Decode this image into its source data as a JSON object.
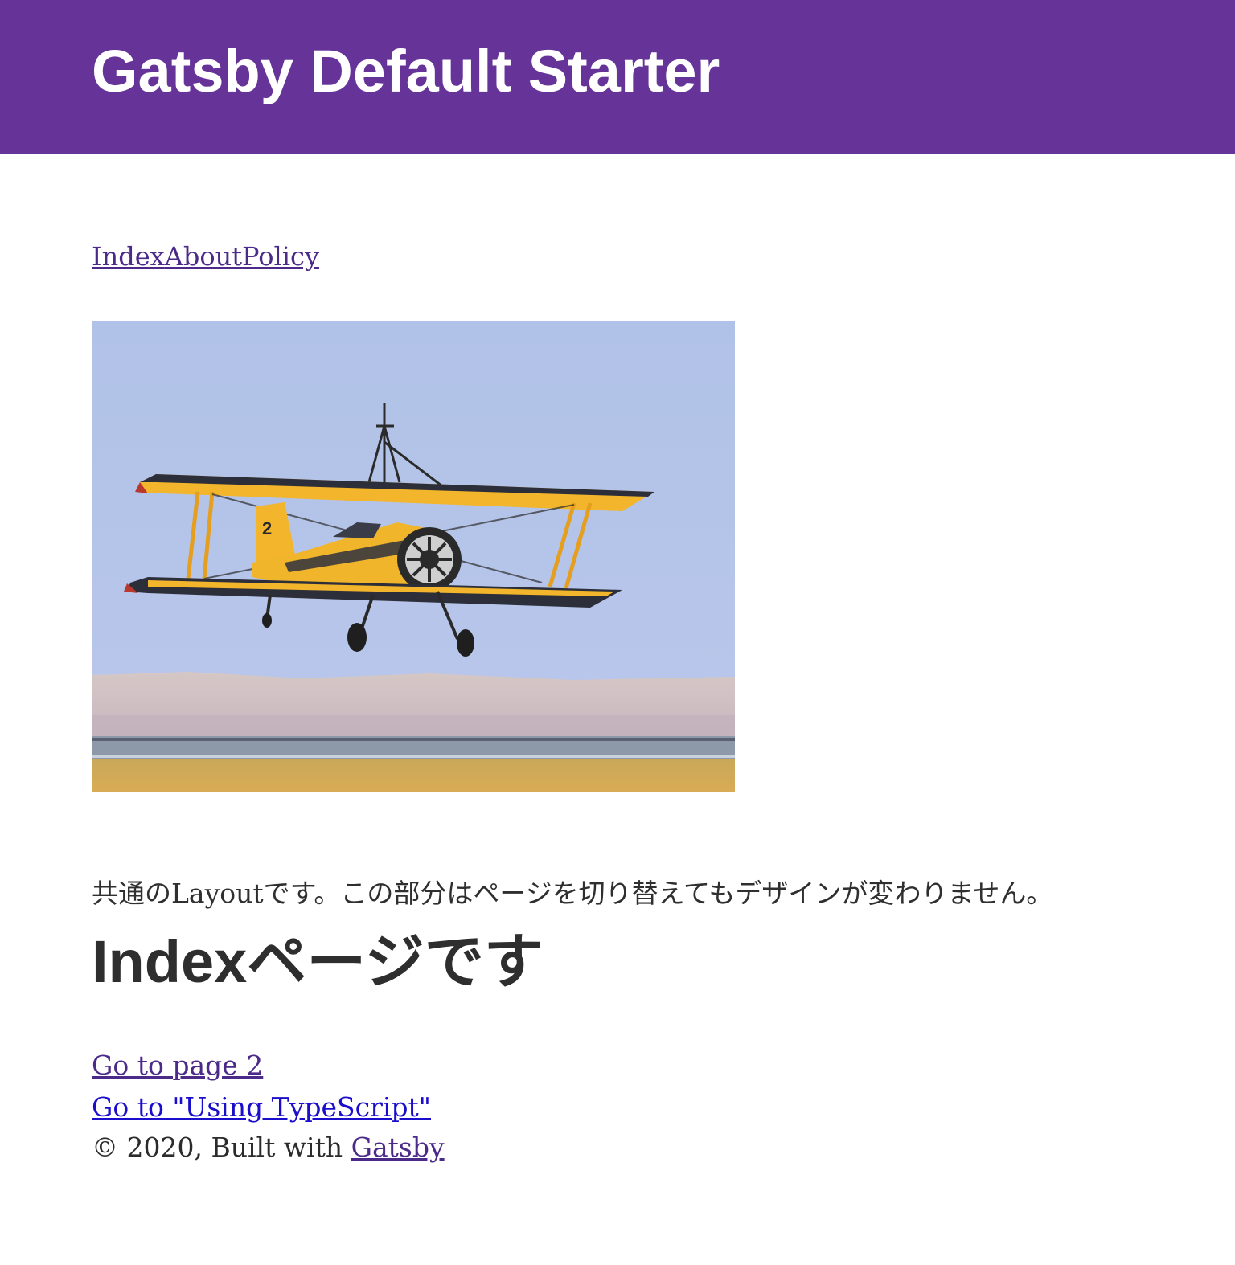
{
  "header": {
    "title": "Gatsby Default Starter",
    "background_color": "#663399"
  },
  "nav": {
    "links": [
      {
        "label": "Index"
      },
      {
        "label": "About"
      },
      {
        "label": "Policy"
      }
    ]
  },
  "hero_image": {
    "plane_number": "2"
  },
  "layout_note": "共通のLayoutです。この部分はページを切り替えてもデザインが変わりません。",
  "page": {
    "heading": "Indexページです"
  },
  "links": {
    "page2": "Go to page 2",
    "typescript": "Go to \"Using TypeScript\""
  },
  "footer": {
    "copyright": "© 2020, Built with ",
    "gatsby_link": "Gatsby"
  }
}
